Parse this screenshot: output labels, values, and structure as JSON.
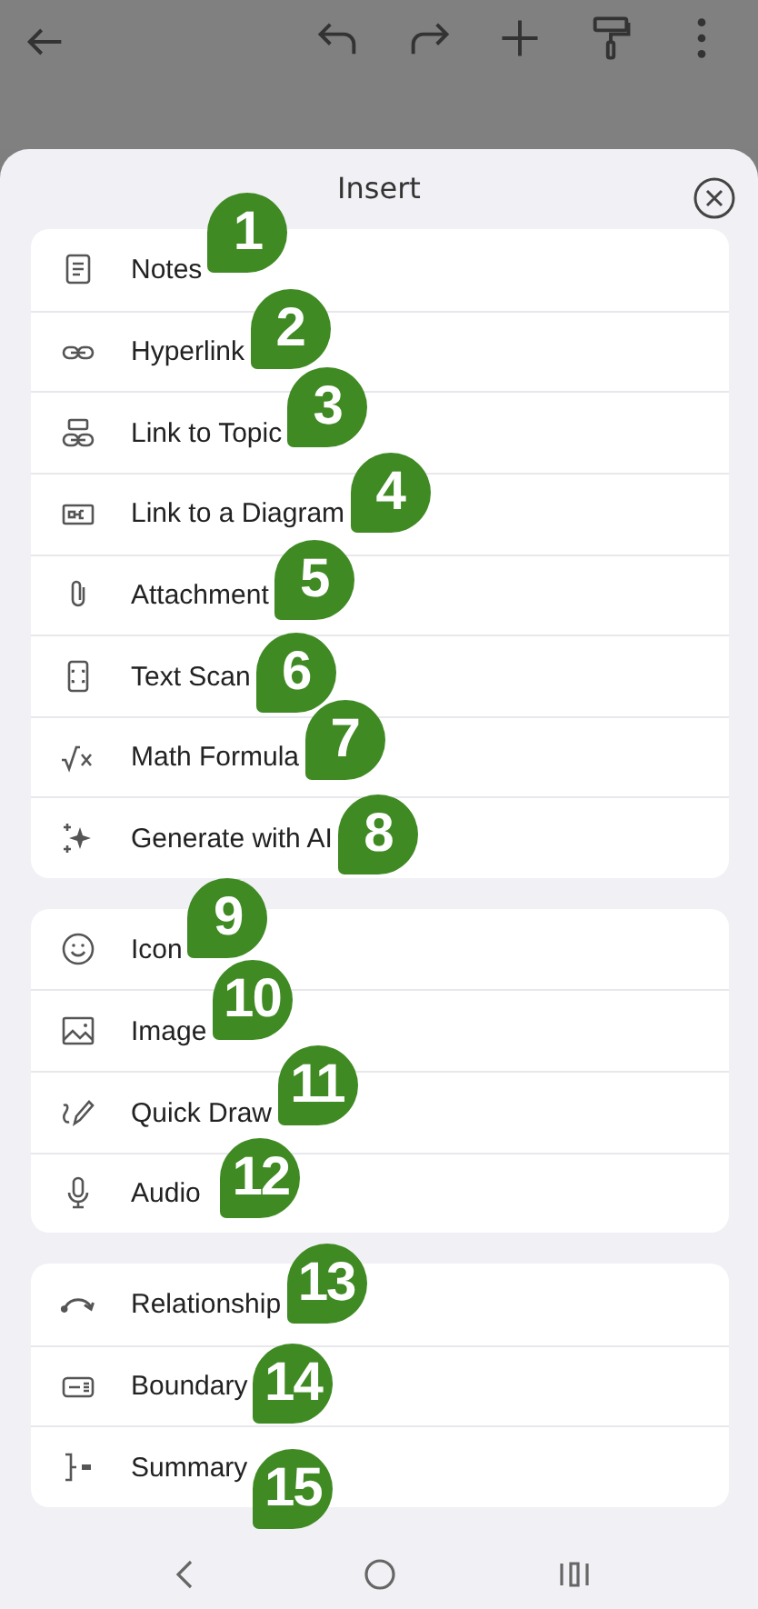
{
  "sheet": {
    "title": "Insert"
  },
  "groups": [
    {
      "items": [
        {
          "label": "Notes",
          "callout": "1"
        },
        {
          "label": "Hyperlink",
          "callout": "2"
        },
        {
          "label": "Link to Topic",
          "callout": "3"
        },
        {
          "label": "Link to a Diagram",
          "callout": "4"
        },
        {
          "label": "Attachment",
          "callout": "5"
        },
        {
          "label": "Text Scan",
          "callout": "6"
        },
        {
          "label": "Math Formula",
          "callout": "7"
        },
        {
          "label": "Generate with AI",
          "callout": "8"
        }
      ]
    },
    {
      "items": [
        {
          "label": "Icon",
          "callout": "9"
        },
        {
          "label": "Image",
          "callout": "10"
        },
        {
          "label": "Quick Draw",
          "callout": "11"
        },
        {
          "label": "Audio",
          "callout": "12"
        }
      ]
    },
    {
      "items": [
        {
          "label": "Relationship",
          "callout": "13"
        },
        {
          "label": "Boundary",
          "callout": "14"
        },
        {
          "label": "Summary",
          "callout": "15"
        }
      ]
    }
  ]
}
